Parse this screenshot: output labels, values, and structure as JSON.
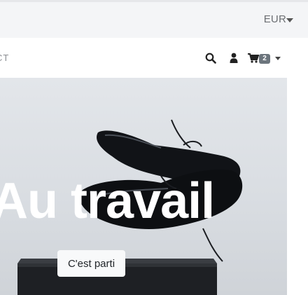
{
  "header": {
    "currency": "EUR"
  },
  "nav": {
    "contact_fragment": "CT",
    "cart_count": "2",
    "icons": [
      "search-icon",
      "user-icon",
      "cart-icon",
      "chevron-down-icon"
    ]
  },
  "hero": {
    "title": "Au travail",
    "button_label": "C'est parti"
  },
  "colors": {
    "topbar_bg": "#f4f5f7",
    "badge_bg": "#6c757d",
    "hero_text": "#ffffff",
    "button_bg": "#f8f9fa"
  }
}
